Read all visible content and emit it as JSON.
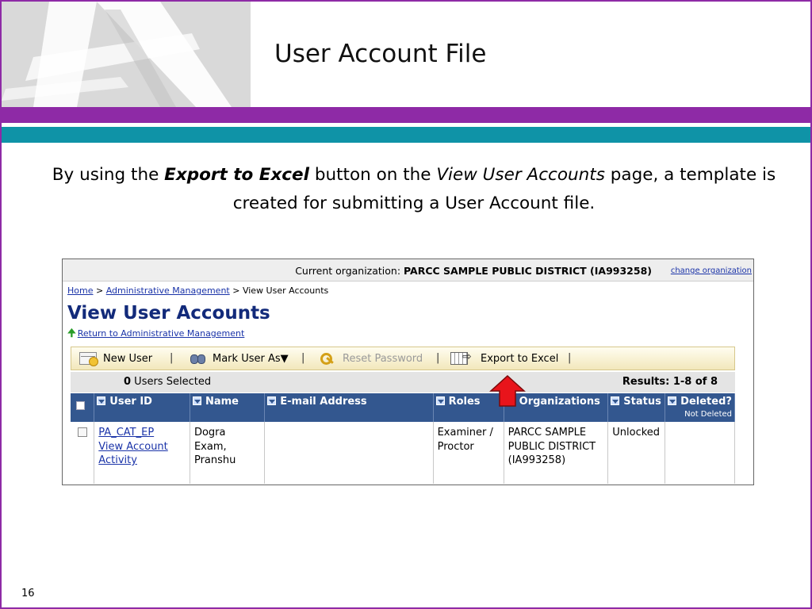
{
  "slide": {
    "title": "User Account File",
    "intro": {
      "p1": "By using the ",
      "emph1": "Export to Excel",
      "p2": " button on the ",
      "emph2": "View User Accounts",
      "p3": " page, a template is created for submitting a User Account file."
    },
    "page_number": "16",
    "colors": {
      "purple": "#8e2aa6",
      "teal": "#0f93a7",
      "logo_bg": "#d9d9d9"
    }
  },
  "screenshot": {
    "org_bar": {
      "label": "Current organization: ",
      "org_name": "PARCC SAMPLE PUBLIC DISTRICT (IA993258)",
      "change_link": "change organization"
    },
    "breadcrumb": {
      "home": "Home",
      "sep": " > ",
      "admin": "Administrative Management",
      "current": "View User Accounts"
    },
    "heading": "View User Accounts",
    "return_link": "Return to Administrative Management",
    "toolbar": {
      "new_user": "New User",
      "mark_user_as": "Mark User As▼",
      "reset_password": "Reset Password",
      "export_to_excel": "Export to Excel",
      "separator": "|"
    },
    "selection": {
      "count": "0",
      "label": " Users Selected"
    },
    "results": "Results: 1-8 of 8",
    "table": {
      "headers": {
        "user_id": "User ID",
        "name": "Name",
        "email": "E-mail Address",
        "roles": "Roles",
        "organizations": "Organizations",
        "status": "Status",
        "deleted": "Deleted?",
        "deleted_filter": "Not Deleted"
      },
      "rows": [
        {
          "user_id": "PA_CAT_EP",
          "activity_link": "View Account Activity",
          "name": "Dogra Exam, Pranshu",
          "email": "",
          "roles": "Examiner / Proctor",
          "organizations": "PARCC SAMPLE PUBLIC DISTRICT (IA993258)",
          "status": "Unlocked",
          "deleted": ""
        }
      ]
    }
  }
}
